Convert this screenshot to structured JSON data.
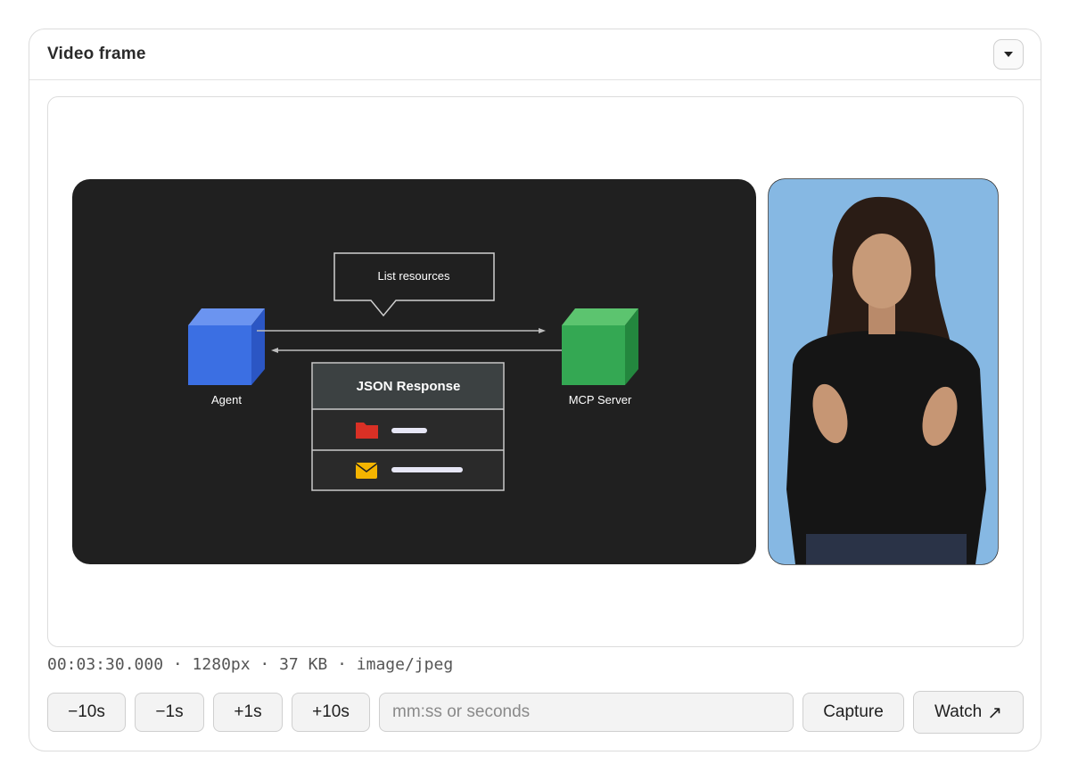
{
  "panel": {
    "title": "Video frame",
    "collapse_icon": "chevron-down-icon"
  },
  "frame": {
    "slide": {
      "bubble_text": "List resources",
      "agent_label": "Agent",
      "server_label": "MCP Server",
      "response_header": "JSON Response",
      "colors": {
        "background": "#202020",
        "agent_cube": "#3b6fe3",
        "server_cube": "#34a853",
        "folder_icon": "#d93025",
        "mail_icon": "#f4b400"
      }
    },
    "presenter": {
      "background": "#7fb1df"
    }
  },
  "meta": {
    "text": "00:03:30.000 · 1280px · 37 KB · image/jpeg"
  },
  "controls": {
    "back10_label": "−10s",
    "back1_label": "−1s",
    "fwd1_label": "+1s",
    "fwd10_label": "+10s",
    "time_placeholder": "mm:ss or seconds",
    "time_value": "",
    "capture_label": "Capture",
    "watch_label": "Watch",
    "watch_icon": "external-arrow-icon"
  }
}
